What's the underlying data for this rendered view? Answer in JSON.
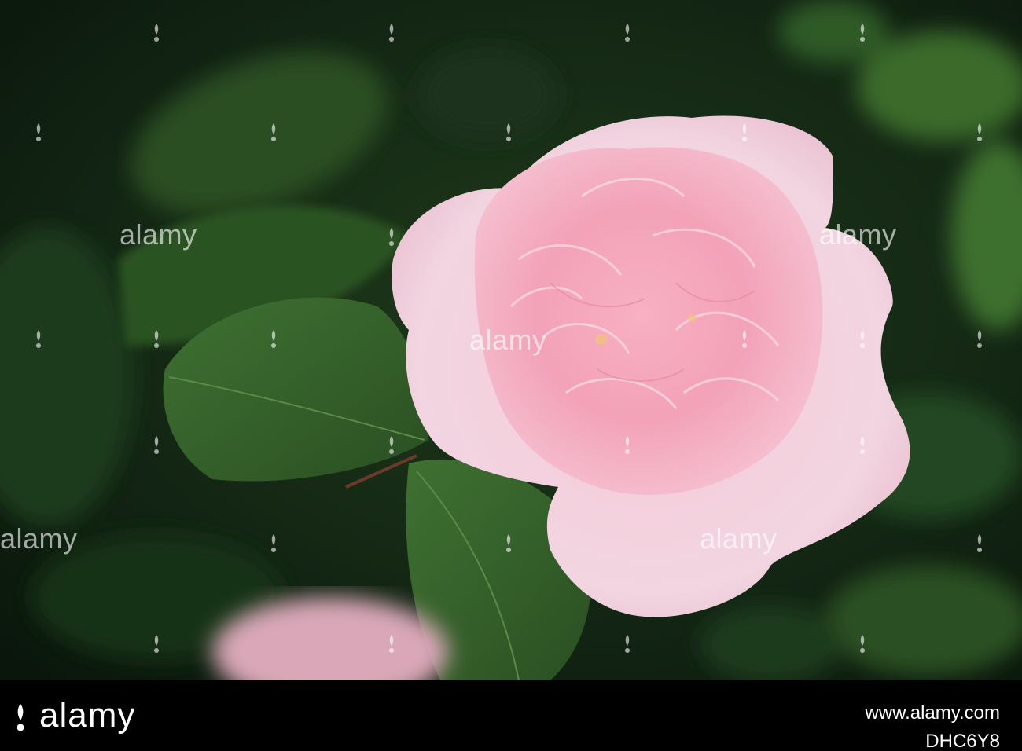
{
  "watermark": {
    "text": "alamy"
  },
  "footer": {
    "brand": "alamy",
    "image_id_lines": [
      "www.alamy.com",
      "DHC6Y8"
    ]
  },
  "colors": {
    "background_dark": "#0f1d10",
    "leaf": "#3b6a2d",
    "petal_outer": "#f3d6e2",
    "petal_inner": "#f3a0b6",
    "footer": "#000000"
  }
}
